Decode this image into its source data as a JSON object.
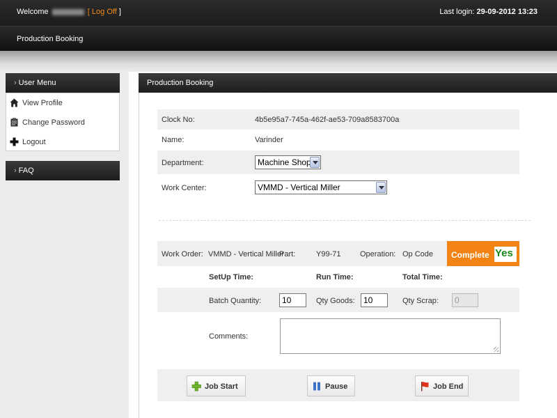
{
  "header": {
    "welcome_label": "Welcome",
    "logoff_open": "[",
    "logoff_label": "Log Off",
    "logoff_close": "]",
    "last_login_label": "Last login:",
    "last_login_value": "29-09-2012 13:23"
  },
  "nav": {
    "current": "Production Booking"
  },
  "sidebar": {
    "user_menu_title": "User Menu",
    "items": [
      {
        "label": "View Profile",
        "icon": "home-icon"
      },
      {
        "label": "Change Password",
        "icon": "clipboard-icon"
      },
      {
        "label": "Logout",
        "icon": "plus-icon"
      }
    ],
    "faq_title": "FAQ"
  },
  "main": {
    "title": "Production Booking",
    "clock_no_label": "Clock No:",
    "clock_no_value": "4b5e95a7-745a-462f-ae53-709a8583700a",
    "name_label": "Name:",
    "name_value": "Varinder",
    "department_label": "Department:",
    "department_value": "Machine Shop",
    "work_center_label": "Work Center:",
    "work_center_value": "VMMD - Vertical Miller",
    "work_order_label": "Work Order:",
    "work_order_value": "VMMD - Vertical Miller",
    "part_label": "Part:",
    "part_value": "Y99-71",
    "operation_label": "Operation:",
    "operation_value": "Op Code",
    "complete_label": "Complete",
    "complete_value": "Yes",
    "setup_time_label": "SetUp Time:",
    "run_time_label": "Run Time:",
    "total_time_label": "Total Time:",
    "batch_qty_label": "Batch Quantity:",
    "batch_qty_value": "10",
    "qty_goods_label": "Qty Goods:",
    "qty_goods_value": "10",
    "qty_scrap_label": "Qty Scrap:",
    "qty_scrap_value": "0",
    "comments_label": "Comments:"
  },
  "buttons": {
    "job_start": "Job Start",
    "pause": "Pause",
    "job_end": "Job End"
  },
  "colors": {
    "accent_orange": "#f28312",
    "logoff_orange": "#f08a1c",
    "yes_green": "#1d8a1d",
    "header_dark": "#1d1d1d"
  }
}
